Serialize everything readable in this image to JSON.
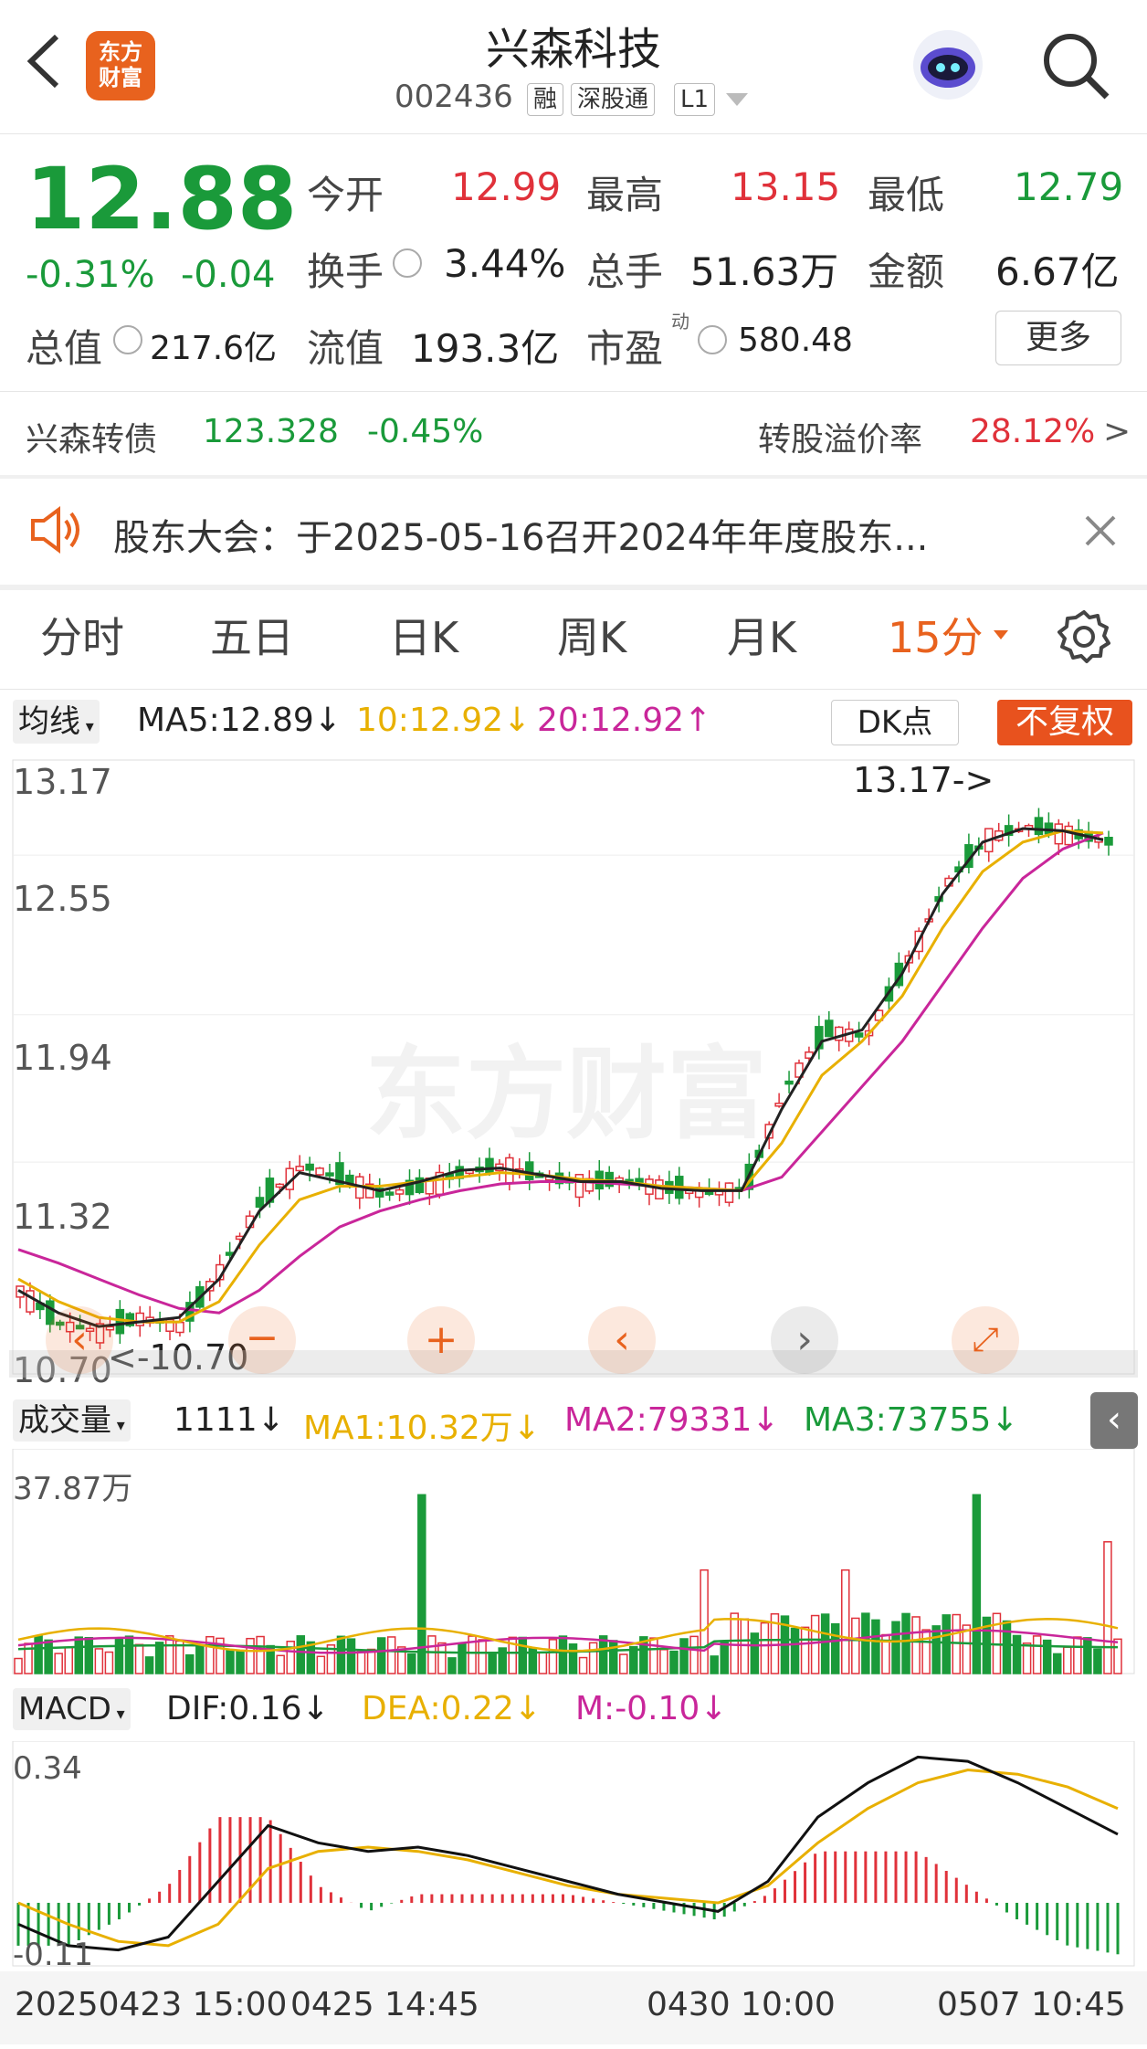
{
  "header": {
    "title": "兴森科技",
    "code": "002436",
    "tags": [
      "融",
      "深股通",
      "L1"
    ],
    "logo_text": [
      "东方",
      "财富"
    ]
  },
  "quote": {
    "price": "12.88",
    "change_pct": "-0.31%",
    "change": "-0.04",
    "open_label": "今开",
    "open": "12.99",
    "high_label": "最高",
    "high": "13.15",
    "low_label": "最低",
    "low": "12.79",
    "turnover_label": "换手",
    "turnover": "3.44%",
    "volume_label": "总手",
    "volume": "51.63万",
    "amount_label": "金额",
    "amount": "6.67亿",
    "total_value_label": "总值",
    "total_value": "217.6亿",
    "float_value_label": "流值",
    "float_value": "193.3亿",
    "pe_label": "市盈",
    "pe_sup": "动",
    "pe": "580.48",
    "more_label": "更多"
  },
  "bond": {
    "name": "兴森转债",
    "price": "123.328",
    "change": "-0.45%",
    "premium_label": "转股溢价率",
    "premium": "28.12%",
    "arrow": ">"
  },
  "notice": {
    "text": "股东大会：于2025-05-16召开2024年年度股东..."
  },
  "tabs": [
    "分时",
    "五日",
    "日K",
    "周K",
    "月K",
    "15分"
  ],
  "ma_bar": {
    "selector": "均线",
    "ma5": "MA5:12.89↓",
    "ma10": "10:12.92↓",
    "ma20": "20:12.92↑",
    "dk": "DK点",
    "fq": "不复权"
  },
  "kline": {
    "y_labels": [
      "13.17",
      "12.55",
      "11.94",
      "11.32",
      "10.70"
    ],
    "max_tag": "13.17->",
    "min_tag": "<-10.70",
    "watermark": "东方财富"
  },
  "volume_bar": {
    "selector": "成交量",
    "cur": "1111↓",
    "ma1": "MA1:10.32万↓",
    "ma2": "MA2:79331↓",
    "ma3": "MA3:73755↓",
    "max_label": "37.87万"
  },
  "macd_bar": {
    "selector": "MACD",
    "dif": "DIF:0.16↓",
    "dea": "DEA:0.22↓",
    "m": "M:-0.10↓",
    "top_label": "0.34",
    "bottom_label": "-0.11"
  },
  "x_axis": [
    "20250423 15:00",
    "0425 14:45",
    "0430 10:00",
    "0507 10:45"
  ],
  "colors": {
    "up": "#e0313a",
    "down": "#1a9a3a",
    "ma5": "#222222",
    "ma10": "#e8b000",
    "ma20": "#c9269a",
    "accent": "#e8621e"
  },
  "chart_data": {
    "type": "candlestick",
    "y_range": [
      10.7,
      13.17
    ],
    "close_path": [
      10.9,
      10.75,
      10.72,
      10.78,
      10.74,
      11.0,
      11.3,
      11.45,
      11.4,
      11.32,
      11.36,
      11.42,
      11.45,
      11.4,
      11.37,
      11.39,
      11.35,
      11.33,
      11.35,
      11.8,
      12.05,
      12.02,
      12.35,
      12.7,
      12.9,
      12.95,
      12.92,
      12.88
    ],
    "ma5": [
      10.9,
      10.8,
      10.74,
      10.76,
      10.78,
      10.95,
      11.25,
      11.42,
      11.38,
      11.34,
      11.38,
      11.43,
      11.44,
      11.41,
      11.38,
      11.38,
      11.35,
      11.34,
      11.34,
      11.7,
      12.0,
      12.05,
      12.3,
      12.65,
      12.88,
      12.94,
      12.93,
      12.89
    ],
    "ma10": [
      10.95,
      10.85,
      10.78,
      10.76,
      10.76,
      10.85,
      11.1,
      11.3,
      11.36,
      11.36,
      11.38,
      11.4,
      11.42,
      11.41,
      11.39,
      11.38,
      11.36,
      11.35,
      11.34,
      11.55,
      11.85,
      12.0,
      12.2,
      12.5,
      12.75,
      12.88,
      12.93,
      12.92
    ],
    "ma20": [
      11.08,
      11.02,
      10.95,
      10.88,
      10.82,
      10.8,
      10.9,
      11.05,
      11.18,
      11.25,
      11.3,
      11.34,
      11.37,
      11.38,
      11.38,
      11.37,
      11.36,
      11.35,
      11.34,
      11.4,
      11.6,
      11.8,
      12.0,
      12.25,
      12.5,
      12.72,
      12.85,
      12.92
    ],
    "volume_max": 378700,
    "macd_dif": [
      -0.05,
      -0.1,
      -0.11,
      -0.08,
      0.05,
      0.18,
      0.14,
      0.12,
      0.13,
      0.11,
      0.08,
      0.05,
      0.02,
      0.0,
      -0.02,
      0.05,
      0.2,
      0.28,
      0.34,
      0.33,
      0.28,
      0.22,
      0.16
    ],
    "macd_dea": [
      0.0,
      -0.05,
      -0.09,
      -0.1,
      -0.05,
      0.08,
      0.12,
      0.13,
      0.12,
      0.1,
      0.07,
      0.04,
      0.02,
      0.01,
      0.0,
      0.04,
      0.14,
      0.22,
      0.28,
      0.31,
      0.3,
      0.27,
      0.22
    ]
  }
}
